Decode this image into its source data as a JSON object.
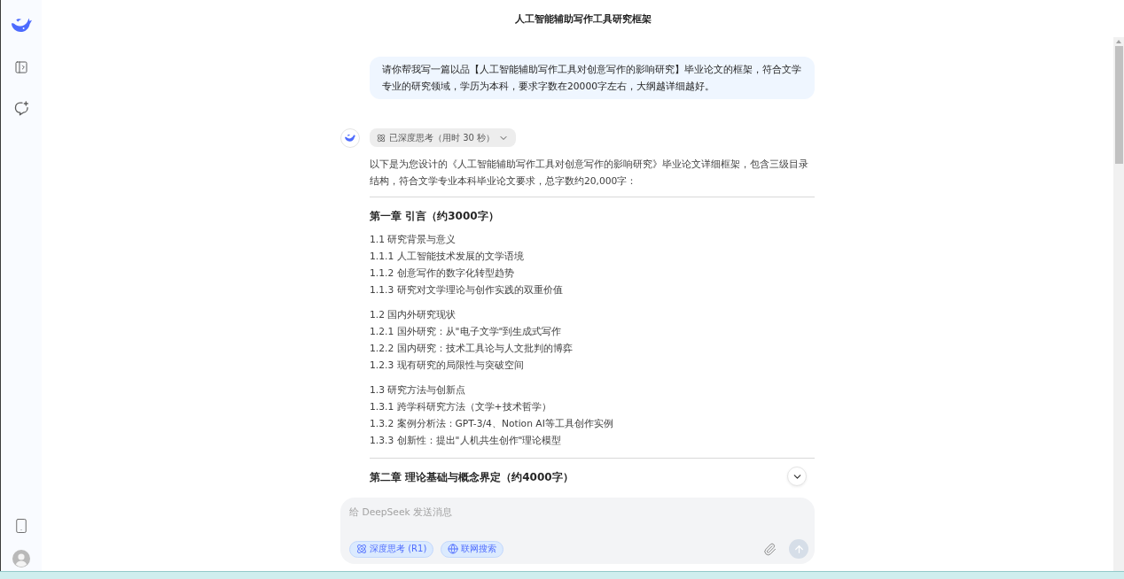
{
  "header": {
    "title": "人工智能辅助写作工具研究框架"
  },
  "conversation": {
    "user_message": "请你帮我写一篇以品【人工智能辅助写作工具对创意写作的影响研究】毕业论文的框架，符合文学专业的研究领域，学历为本科，要求字数在20000字左右，大纲越详细越好。",
    "reply": {
      "thinking": {
        "label": "已深度思考（用时 30 秒）",
        "expanded": false
      },
      "intro": "以下是为您设计的《人工智能辅助写作工具对创意写作的影响研究》毕业论文详细框架，包含三级目录结构，符合文学专业本科毕业论文要求，总字数约20,000字：",
      "sections": [
        {
          "heading": "第一章 引言（约3000字）",
          "groups": [
            [
              "1.1 研究背景与意义",
              "1.1.1 人工智能技术发展的文学语境",
              "1.1.2 创意写作的数字化转型趋势",
              "1.1.3 研究对文学理论与创作实践的双重价值"
            ],
            [
              "1.2 国内外研究现状",
              "1.2.1 国外研究：从\"电子文学\"到生成式写作",
              "1.2.2 国内研究：技术工具论与人文批判的博弈",
              "1.2.3 现有研究的局限性与突破空间"
            ],
            [
              "1.3 研究方法与创新点",
              "1.3.1 跨学科研究方法（文学+技术哲学）",
              "1.3.2 案例分析法：GPT-3/4、Notion AI等工具创作实例",
              "1.3.3 创新性：提出\"人机共生创作\"理论模型"
            ]
          ]
        },
        {
          "heading": "第二章 理论基础与概念界定（约4000字）"
        }
      ]
    }
  },
  "composer": {
    "placeholder": "给 DeepSeek 发送消息",
    "toggles": [
      {
        "kind": "think",
        "label": "深度思考 (R1)",
        "selected": true
      },
      {
        "kind": "search",
        "label": "联网搜索",
        "selected": true
      }
    ],
    "send_disabled": true
  }
}
